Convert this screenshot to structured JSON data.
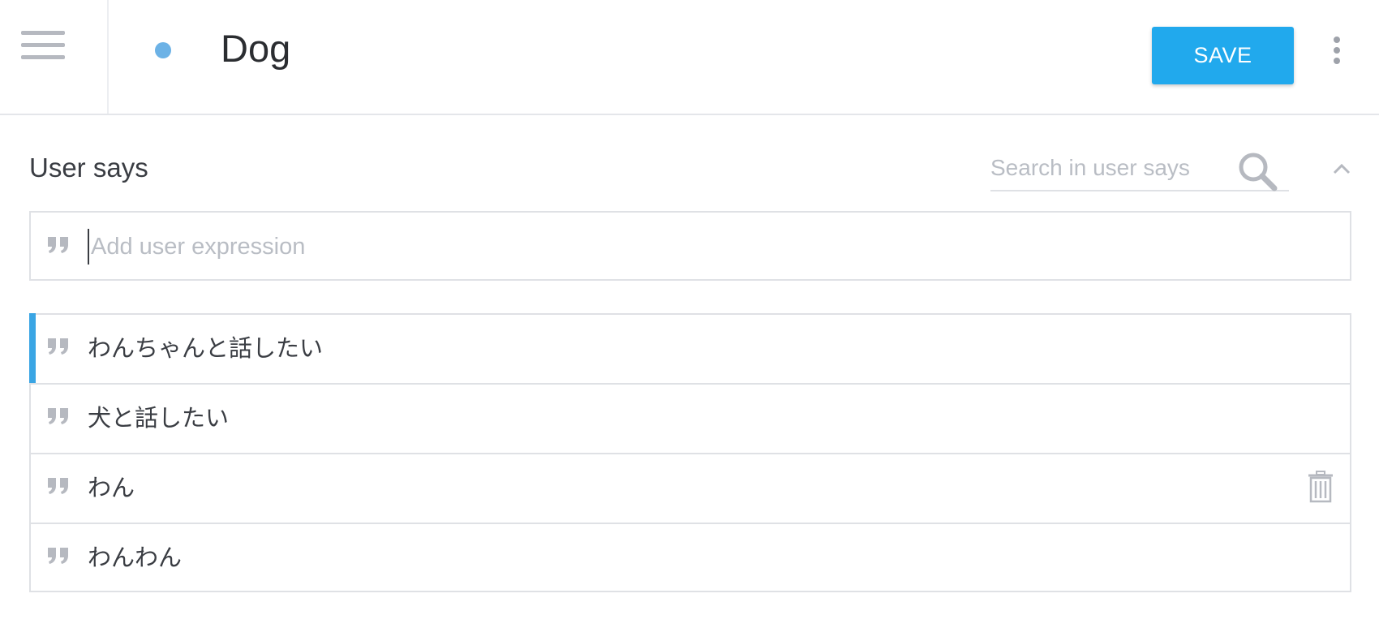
{
  "header": {
    "title": "Dog",
    "save_label": "SAVE",
    "status_color": "#6cb2e6"
  },
  "user_says": {
    "section_title": "User says",
    "search_placeholder": "Search in user says",
    "add_placeholder": "Add user expression",
    "expressions": [
      {
        "text": "わんちゃんと話したい",
        "active": true
      },
      {
        "text": "犬と話したい",
        "active": false
      },
      {
        "text": "わん",
        "active": false,
        "show_delete": true
      },
      {
        "text": "わんわん",
        "active": false
      }
    ]
  },
  "icons": {
    "menu": "hamburger-icon",
    "more": "more-vertical-icon",
    "search": "search-icon",
    "collapse": "chevron-up-icon",
    "quote": "quote-icon",
    "delete": "trash-icon"
  },
  "colors": {
    "accent": "#21a9ed",
    "active_bar": "#3aa5e4",
    "icon_gray": "#b6b9c0",
    "text": "#3a3d43"
  }
}
